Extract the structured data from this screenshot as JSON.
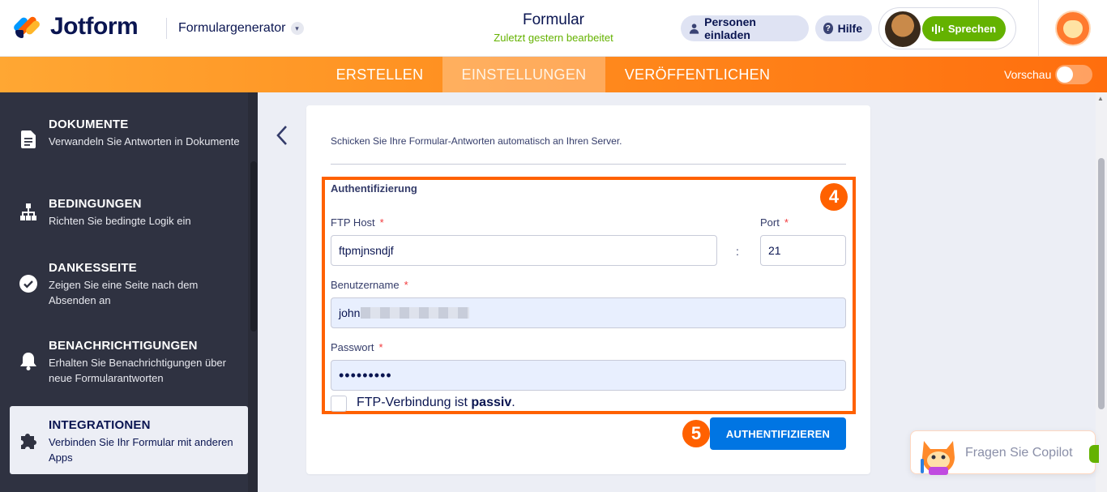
{
  "header": {
    "brand": "Jotform",
    "app_menu": "Formulargenerator",
    "form_title": "Formular",
    "form_status": "Zuletzt gestern bearbeitet",
    "invite_label": "Personen einladen",
    "help_label": "Hilfe",
    "speak_label": "Sprechen"
  },
  "nav": {
    "tabs": [
      {
        "label": "ERSTELLEN"
      },
      {
        "label": "EINSTELLUNGEN"
      },
      {
        "label": "VERÖFFENTLICHEN"
      }
    ],
    "preview_label": "Vorschau"
  },
  "sidebar": {
    "items": [
      {
        "title": "DOKUMENTE",
        "desc": "Verwandeln Sie Antworten in Dokumente"
      },
      {
        "title": "BEDINGUNGEN",
        "desc": "Richten Sie bedingte Logik ein"
      },
      {
        "title": "DANKESSEITE",
        "desc": "Zeigen Sie eine Seite nach dem Absenden an"
      },
      {
        "title": "BENACHRICHTIGUNGEN",
        "desc": "Erhalten Sie Benachrichtigungen über neue Formularantworten"
      },
      {
        "title": "INTEGRATIONEN",
        "desc": "Verbinden Sie Ihr Formular mit anderen Apps"
      }
    ]
  },
  "panel": {
    "intro": "Schicken Sie Ihre Formular-Antworten automatisch an Ihren Server.",
    "section_title": "Authentifizierung",
    "ftp_host_label": "FTP Host",
    "ftp_host_value": "ftpmjnsndjf",
    "separator": ":",
    "port_label": "Port",
    "port_value": "21",
    "username_label": "Benutzername",
    "username_value": "john",
    "password_label": "Passwort",
    "password_value": "•••••••••",
    "passive_label_prefix": "FTP-Verbindung ist ",
    "passive_label_bold": "passiv",
    "passive_label_suffix": ".",
    "required_mark": "*",
    "auth_button": "AUTHENTIFIZIEREN",
    "step_markers": [
      "4",
      "5"
    ]
  },
  "copilot": {
    "label": "Fragen Sie Copilot"
  },
  "colors": {
    "brand_orange": "#ff6100",
    "primary_blue": "#0075e3",
    "success_green": "#64b200",
    "sidebar_bg": "#2f3241"
  }
}
